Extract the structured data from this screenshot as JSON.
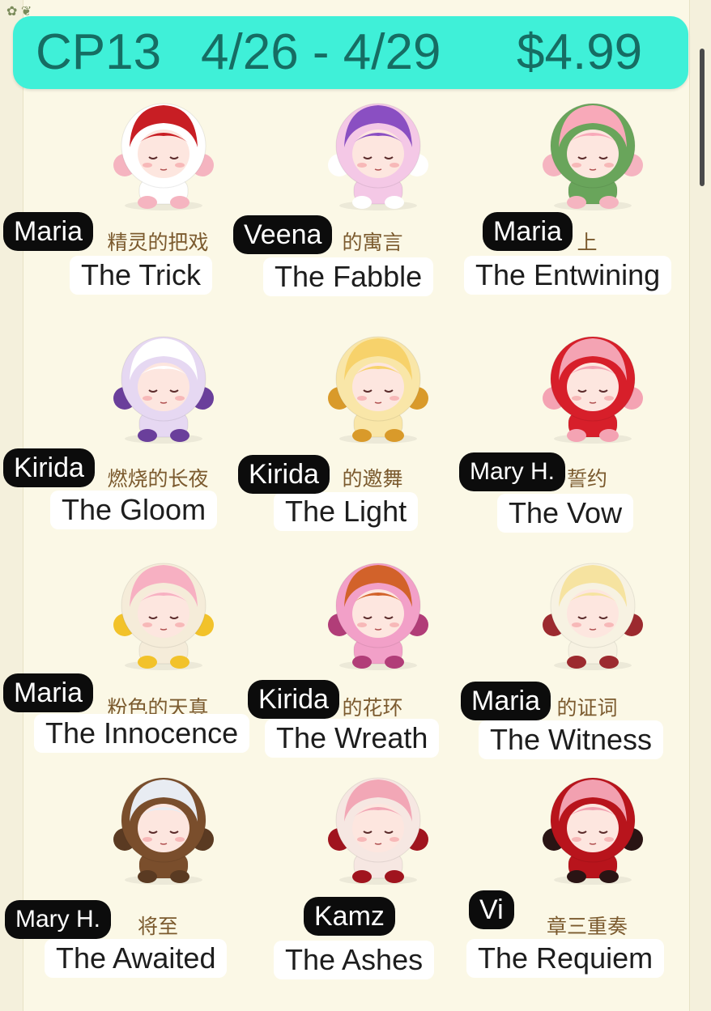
{
  "banner": {
    "code": "CP13",
    "dates": "4/26 - 4/29",
    "price": "$4.99",
    "background_color": "#3ff0d8",
    "text_color": "#166d63"
  },
  "items": [
    {
      "owner": "Maria",
      "name": "The Trick",
      "subtitle_zh": "精灵的把戏",
      "hair": "#c81e24",
      "hood": "#ffffff",
      "accent": "#f5b4c0"
    },
    {
      "owner": "Veena",
      "name": "The Fabble",
      "subtitle_zh": "的寓言",
      "hair": "#8a4fc2",
      "hood": "#f4c8e6",
      "accent": "#ffffff"
    },
    {
      "owner": "Maria",
      "name": "The Entwining",
      "subtitle_zh": "上",
      "hair": "#f8a9b9",
      "hood": "#69a55b",
      "accent": "#f5b4c0"
    },
    {
      "owner": "Kirida",
      "name": "The Gloom",
      "subtitle_zh": "燃烧的长夜",
      "hair": "#ffffff",
      "hood": "#e6d8f2",
      "accent": "#6a3f9b"
    },
    {
      "owner": "Kirida",
      "name": "The Light",
      "subtitle_zh": "的邀舞",
      "hair": "#f7d26b",
      "hood": "#f9e6a8",
      "accent": "#d99a2a"
    },
    {
      "owner": "Mary H.",
      "name": "The Vow",
      "subtitle_zh": "誓约",
      "hair": "#f4a3b3",
      "hood": "#d71f2a",
      "accent": "#f4a3b3"
    },
    {
      "owner": "Maria",
      "name": "The Innocence",
      "subtitle_zh": "粉色的天真",
      "hair": "#f7b0c2",
      "hood": "#f5ecd9",
      "accent": "#f2c22a"
    },
    {
      "owner": "Kirida",
      "name": "The Wreath",
      "subtitle_zh": "的花环",
      "hair": "#d2622a",
      "hood": "#f2a0c8",
      "accent": "#b13d78"
    },
    {
      "owner": "Maria",
      "name": "The Witness",
      "subtitle_zh": "的证词",
      "hair": "#f6e3a0",
      "hood": "#f7f2e2",
      "accent": "#9c2a2f"
    },
    {
      "owner": "Mary H.",
      "name": "The Awaited",
      "subtitle_zh": "将至",
      "hair": "#e8ecf2",
      "hood": "#7a4e2c",
      "accent": "#5a3a22"
    },
    {
      "owner": "Kamz",
      "name": "The Ashes",
      "subtitle_zh": "",
      "hair": "#f2a7b6",
      "hood": "#f6e7e2",
      "accent": "#a0141e"
    },
    {
      "owner": "Vi",
      "name": "The Requiem",
      "subtitle_zh": "章三重奏",
      "hair": "#f2a0b0",
      "hood": "#b8141c",
      "accent": "#2a1414"
    }
  ]
}
